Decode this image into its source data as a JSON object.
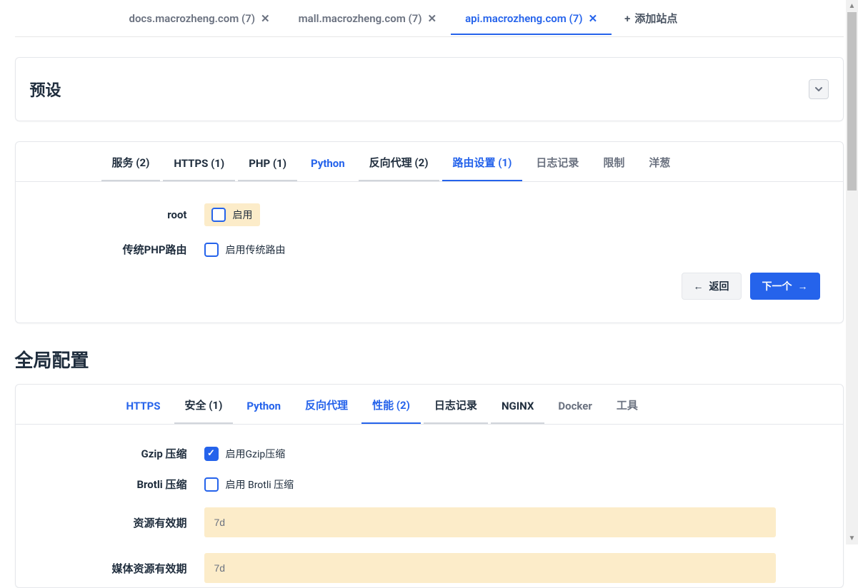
{
  "site_tabs": [
    {
      "label": "docs.macrozheng.com (7)",
      "active": false
    },
    {
      "label": "mall.macrozheng.com (7)",
      "active": false
    },
    {
      "label": "api.macrozheng.com (7)",
      "active": true
    }
  ],
  "add_site_label": "添加站点",
  "preset": {
    "title": "预设"
  },
  "config_tabs": [
    {
      "label": "服务 (2)",
      "state": "visited"
    },
    {
      "label": "HTTPS (1)",
      "state": "visited"
    },
    {
      "label": "PHP (1)",
      "state": "visited"
    },
    {
      "label": "Python",
      "state": "link"
    },
    {
      "label": "反向代理 (2)",
      "state": "visited"
    },
    {
      "label": "路由设置 (1)",
      "state": "active"
    },
    {
      "label": "日志记录",
      "state": ""
    },
    {
      "label": "限制",
      "state": ""
    },
    {
      "label": "洋葱",
      "state": ""
    }
  ],
  "route": {
    "root_label": "root",
    "root_check_label": "启用",
    "php_label": "传统PHP路由",
    "php_check_label": "启用传统路由"
  },
  "buttons": {
    "back": "返回",
    "next": "下一个"
  },
  "global_title": "全局配置",
  "global_tabs": [
    {
      "label": "HTTPS",
      "state": "link"
    },
    {
      "label": "安全 (1)",
      "state": "visited"
    },
    {
      "label": "Python",
      "state": "link"
    },
    {
      "label": "反向代理",
      "state": "link"
    },
    {
      "label": "性能 (2)",
      "state": "active"
    },
    {
      "label": "日志记录",
      "state": "visited"
    },
    {
      "label": "NGINX",
      "state": "visited"
    },
    {
      "label": "Docker",
      "state": ""
    },
    {
      "label": "工具",
      "state": ""
    }
  ],
  "perf": {
    "gzip_label": "Gzip 压缩",
    "gzip_check_label": "启用Gzip压缩",
    "brotli_label": "Brotli 压缩",
    "brotli_check_label": "启用 Brotli 压缩",
    "asset_label": "资源有效期",
    "asset_value": "7d",
    "media_label": "媒体资源有效期",
    "media_value": "7d"
  }
}
